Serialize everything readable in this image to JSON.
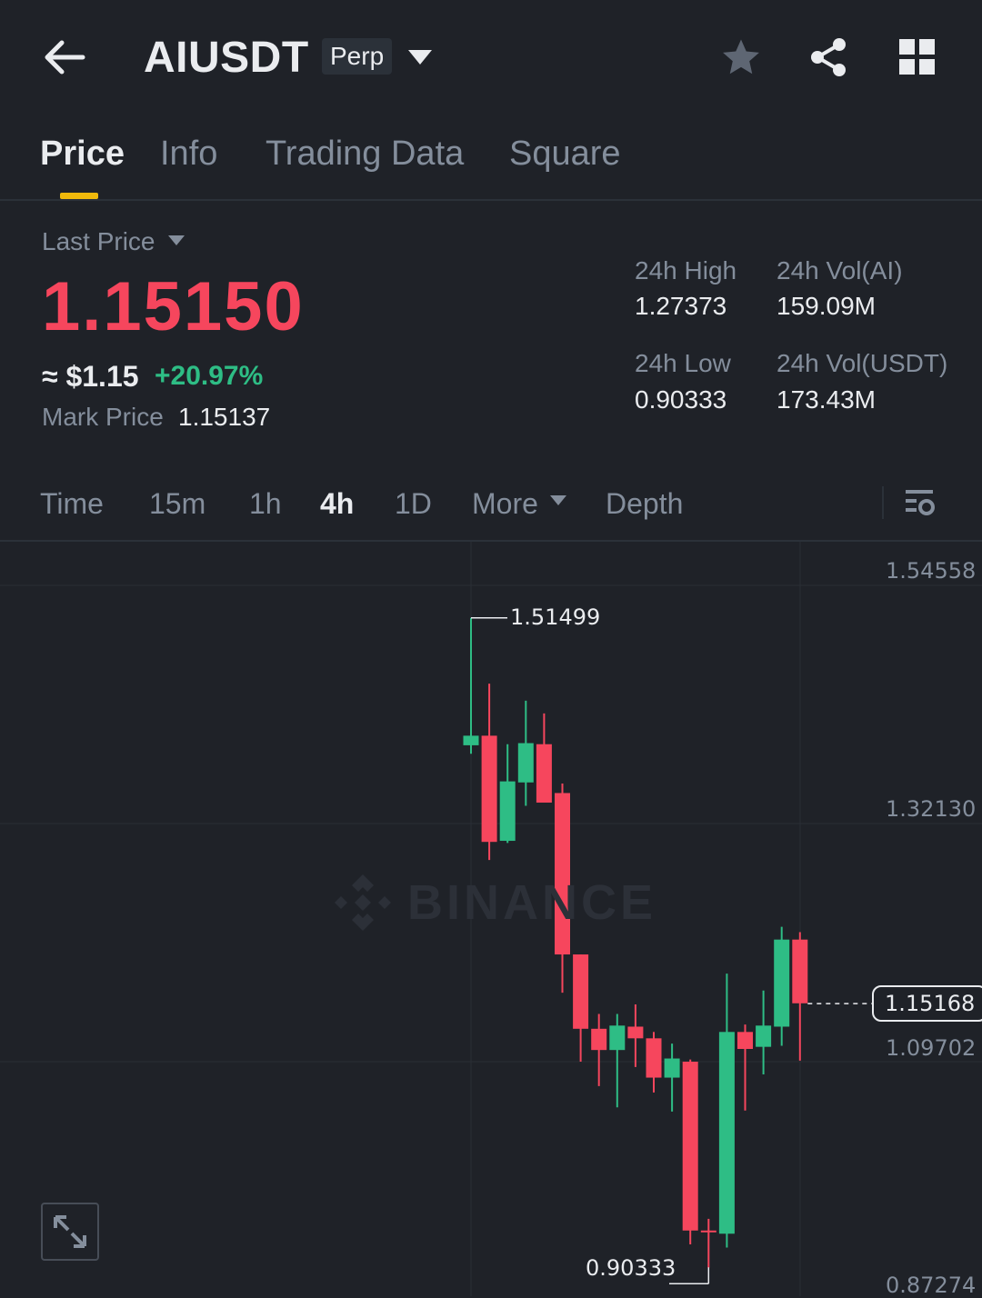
{
  "header": {
    "symbol": "AIUSDT",
    "contract_type": "Perp",
    "icons": [
      "back-arrow-icon",
      "chevron-down-icon",
      "star-icon",
      "share-icon",
      "grid-icon"
    ]
  },
  "tabs": [
    {
      "label": "Price",
      "active": true
    },
    {
      "label": "Info",
      "active": false
    },
    {
      "label": "Trading Data",
      "active": false
    },
    {
      "label": "Square",
      "active": false
    }
  ],
  "price": {
    "last_price_label": "Last Price",
    "last_price": "1.15150",
    "usd_approx": "≈ $1.15",
    "change_pct": "+20.97%",
    "mark_price_label": "Mark Price",
    "mark_price": "1.15137"
  },
  "stats": {
    "high_label": "24h High",
    "high": "1.27373",
    "low_label": "24h Low",
    "low": "0.90333",
    "vol_ai_label": "24h Vol(AI)",
    "vol_ai": "159.09M",
    "vol_usdt_label": "24h Vol(USDT)",
    "vol_usdt": "173.43M"
  },
  "timeframes": [
    {
      "label": "Time",
      "active": false
    },
    {
      "label": "15m",
      "active": false
    },
    {
      "label": "1h",
      "active": false
    },
    {
      "label": "4h",
      "active": true
    },
    {
      "label": "1D",
      "active": false
    },
    {
      "label": "More",
      "active": false
    },
    {
      "label": "Depth",
      "active": false
    }
  ],
  "colors": {
    "up": "#2ebd85",
    "down": "#f6465d",
    "accent": "#f0b90b",
    "background": "#1f2228"
  },
  "chart_data": {
    "type": "candlestick",
    "y_axis_labels": [
      "1.54558",
      "1.32130",
      "1.09702",
      "0.87274"
    ],
    "ylim": [
      0.87274,
      1.54558
    ],
    "current_price_tag": "1.15168",
    "max_annotation": "1.51499",
    "min_annotation": "0.90333",
    "watermark": "BINANCE",
    "candles": [
      {
        "o": 1.395,
        "h": 1.515,
        "l": 1.387,
        "c": 1.404
      },
      {
        "o": 1.404,
        "h": 1.453,
        "l": 1.287,
        "c": 1.304
      },
      {
        "o": 1.305,
        "h": 1.396,
        "l": 1.303,
        "c": 1.361
      },
      {
        "o": 1.36,
        "h": 1.437,
        "l": 1.338,
        "c": 1.397
      },
      {
        "o": 1.396,
        "h": 1.425,
        "l": 1.342,
        "c": 1.341
      },
      {
        "o": 1.35,
        "h": 1.359,
        "l": 1.162,
        "c": 1.198
      },
      {
        "o": 1.198,
        "h": 1.198,
        "l": 1.097,
        "c": 1.128
      },
      {
        "o": 1.128,
        "h": 1.142,
        "l": 1.074,
        "c": 1.108
      },
      {
        "o": 1.108,
        "h": 1.142,
        "l": 1.054,
        "c": 1.131
      },
      {
        "o": 1.13,
        "h": 1.151,
        "l": 1.092,
        "c": 1.119
      },
      {
        "o": 1.119,
        "h": 1.125,
        "l": 1.068,
        "c": 1.082
      },
      {
        "o": 1.082,
        "h": 1.114,
        "l": 1.05,
        "c": 1.1
      },
      {
        "o": 1.097,
        "h": 1.099,
        "l": 0.925,
        "c": 0.938
      },
      {
        "o": 0.938,
        "h": 0.949,
        "l": 0.903,
        "c": 0.937
      },
      {
        "o": 0.935,
        "h": 1.18,
        "l": 0.922,
        "c": 1.125
      },
      {
        "o": 1.125,
        "h": 1.132,
        "l": 1.051,
        "c": 1.109
      },
      {
        "o": 1.111,
        "h": 1.164,
        "l": 1.085,
        "c": 1.131
      },
      {
        "o": 1.13,
        "h": 1.224,
        "l": 1.112,
        "c": 1.212
      },
      {
        "o": 1.212,
        "h": 1.219,
        "l": 1.098,
        "c": 1.152
      }
    ]
  }
}
